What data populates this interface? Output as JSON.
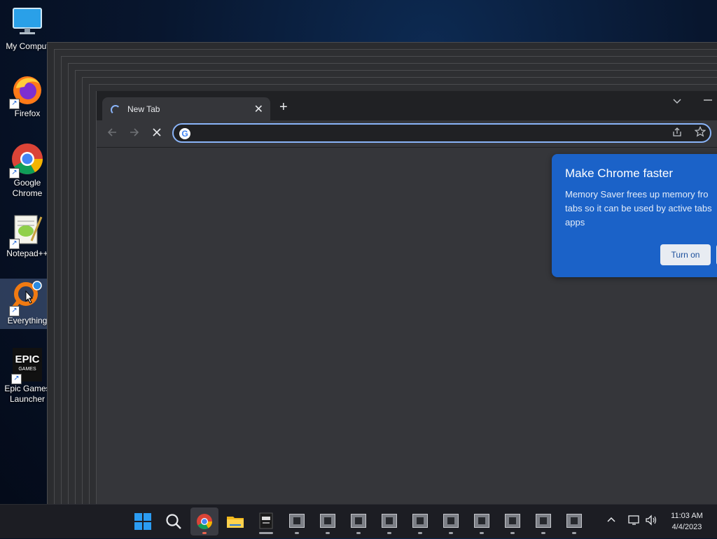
{
  "desktop": {
    "icons": [
      {
        "label": "My Comput",
        "icon": "computer-icon"
      },
      {
        "label": "Firefox",
        "icon": "firefox-icon"
      },
      {
        "label": "Google Chrome",
        "icon": "chrome-icon"
      },
      {
        "label": "Notepad++",
        "icon": "notepad-plus-plus-icon"
      },
      {
        "label": "Everything",
        "icon": "everything-search-icon"
      },
      {
        "label": "Epic Games Launcher",
        "icon": "epic-games-icon"
      }
    ],
    "epic_logo_text": "EPIC",
    "epic_logo_sub": "GAMES"
  },
  "browser": {
    "tab_title": "New Tab",
    "tab_close": "✕",
    "new_tab": "+",
    "omnibox_value": "",
    "omnibox_placeholder": "",
    "promo": {
      "title": "Make Chrome faster",
      "body": "Memory Saver frees up memory fro\ntabs so it can be used by active tabs\napps",
      "button": "Turn on"
    }
  },
  "taskbar": {
    "apps": [
      "start-button",
      "search-button",
      "chrome-app",
      "file-explorer-app",
      "epic-games-app",
      "app-1",
      "app-2",
      "app-3",
      "app-4",
      "app-5",
      "app-6",
      "app-7",
      "app-8",
      "app-9",
      "app-10"
    ],
    "time": "11:03 AM",
    "date": "4/4/2023"
  },
  "colors": {
    "accent": "#8ab4f8",
    "promo_bg": "#1b62c8",
    "tab_bg": "#35363a",
    "tabstrip_bg": "#202124",
    "windows_blue": "#2b9cf2"
  }
}
